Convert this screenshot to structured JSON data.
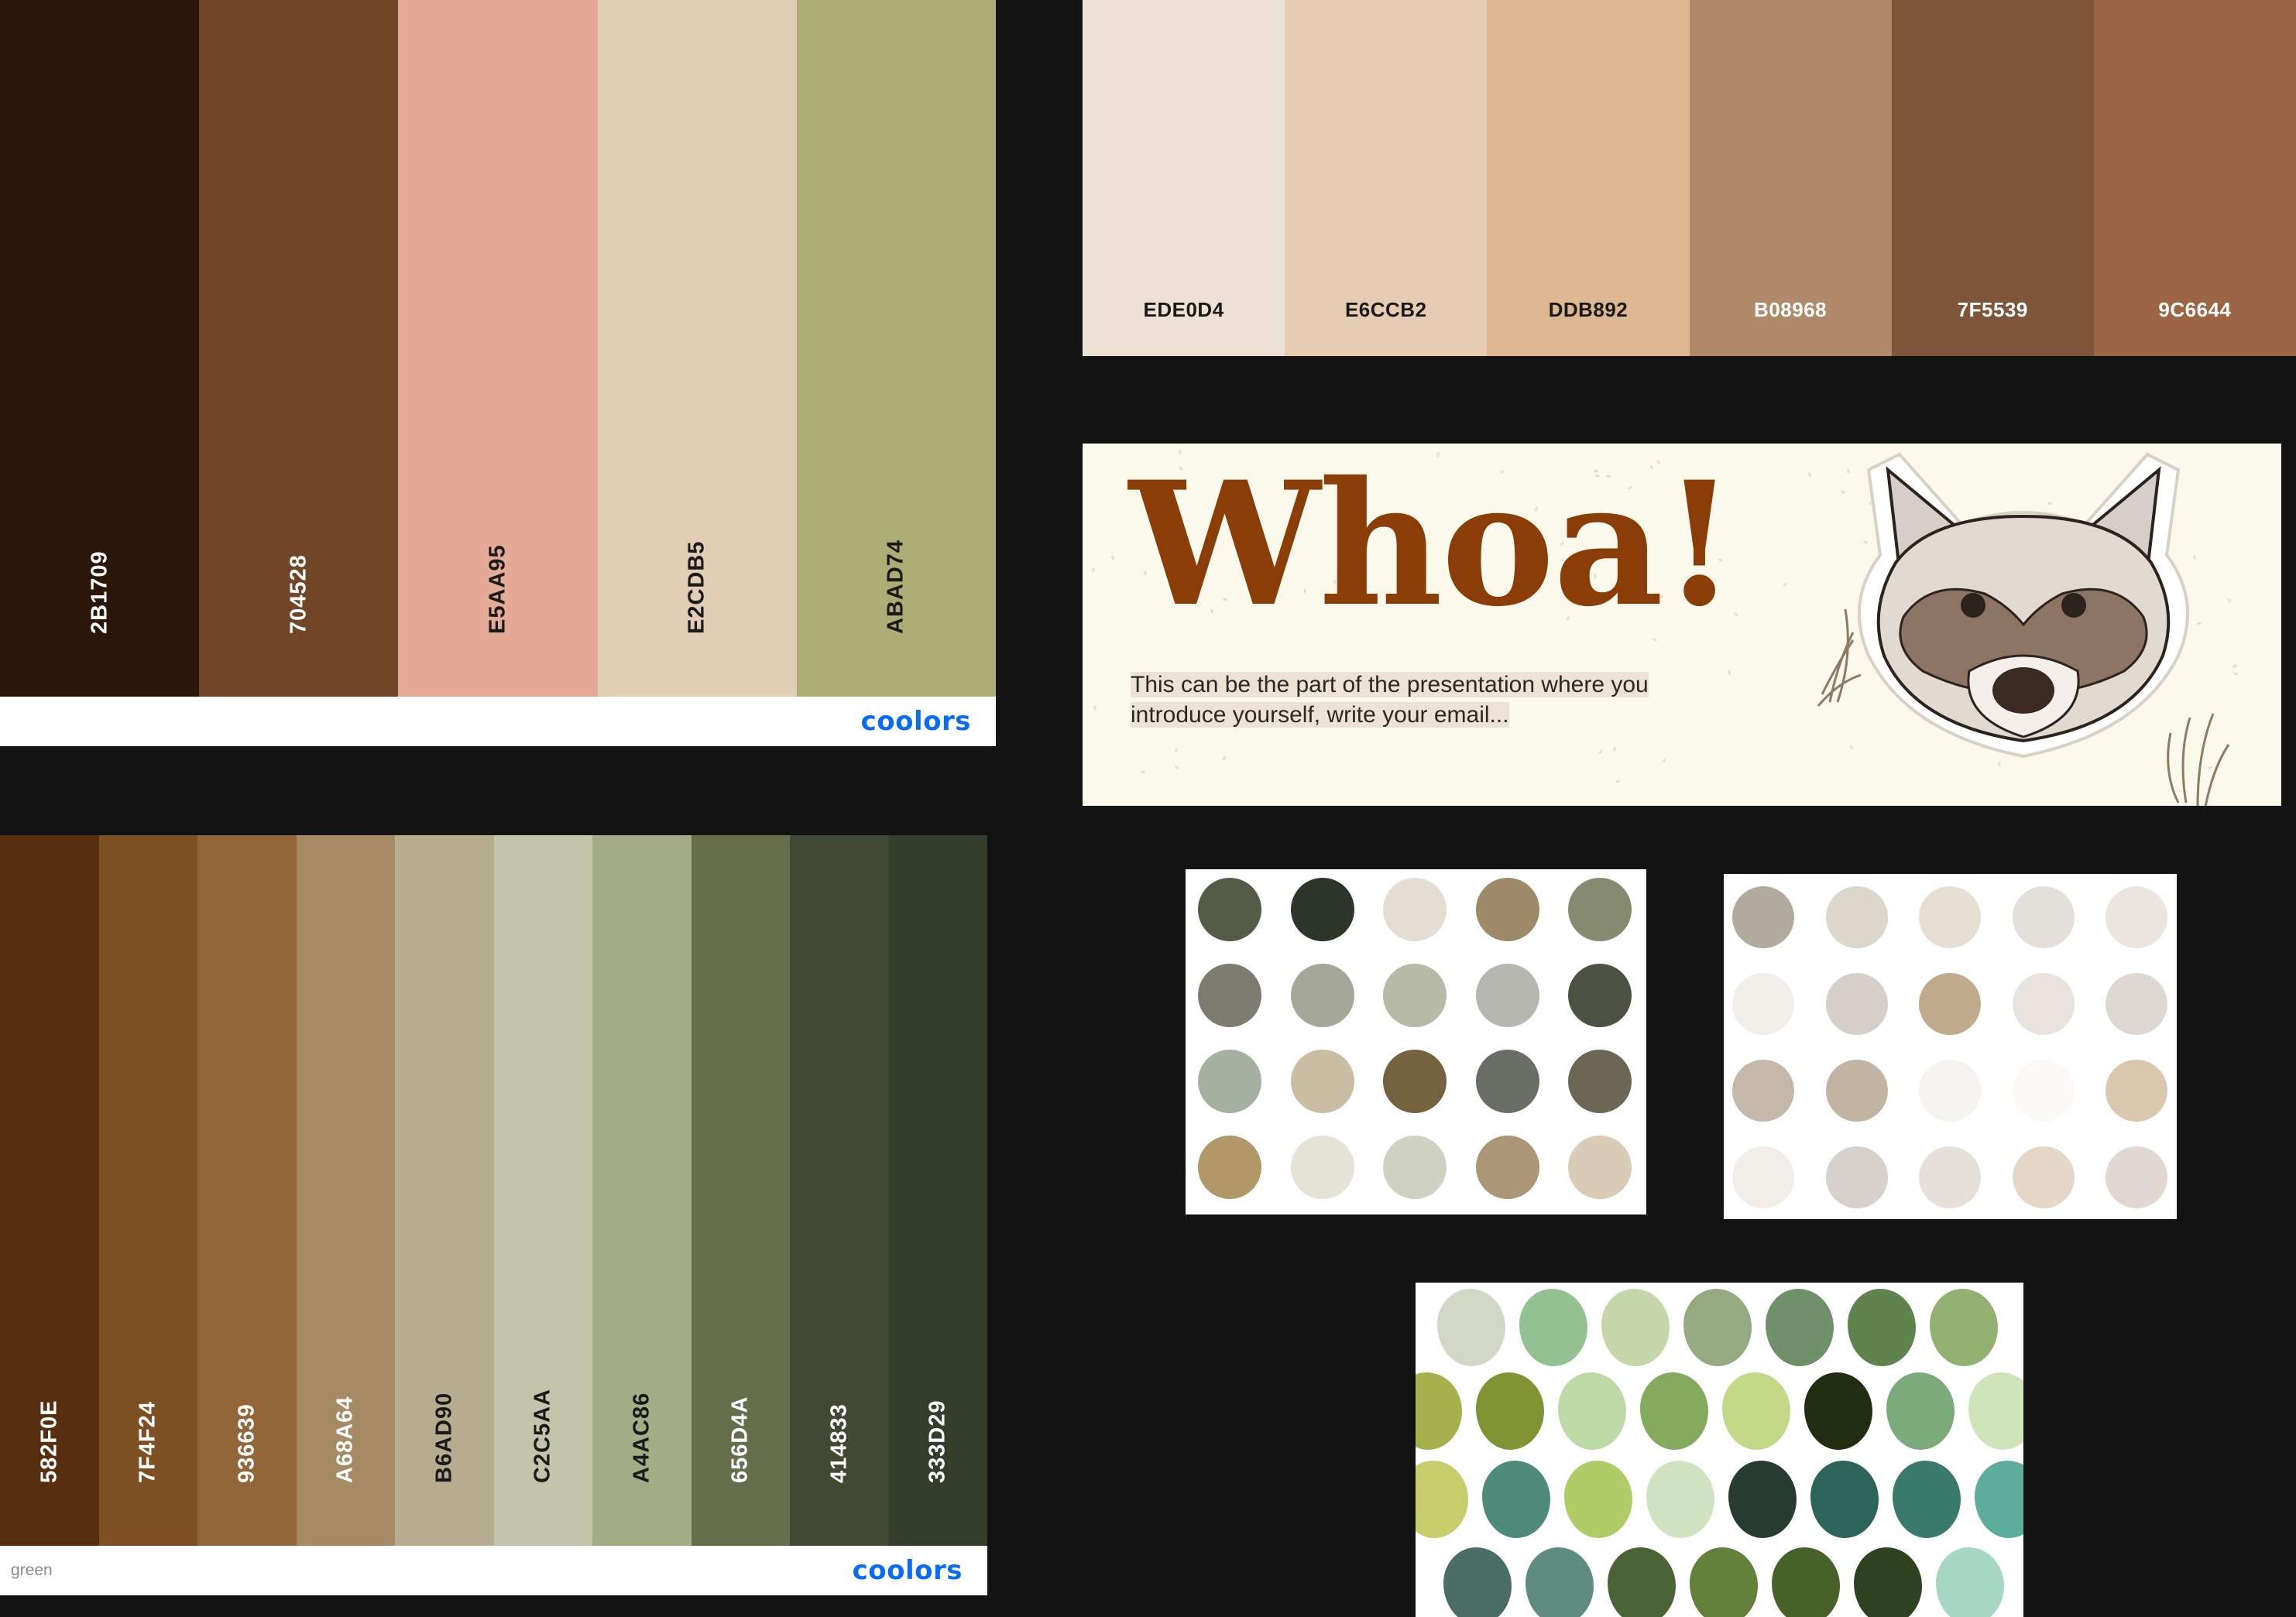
{
  "palette_brown": {
    "colors": [
      {
        "hex": "2B1709",
        "label": "2B1709",
        "text": "#ffffff"
      },
      {
        "hex": "704528",
        "label": "704528",
        "text": "#ffffff"
      },
      {
        "hex": "E5AA95",
        "label": "E5AA95",
        "text": "#1a1a1a"
      },
      {
        "hex": "E2CDB5",
        "label": "E2CDB5",
        "text": "#1a1a1a"
      },
      {
        "hex": "ABAD74",
        "label": "ABAD74",
        "text": "#1a1a1a"
      }
    ],
    "logo": "coolors"
  },
  "palette_green": {
    "colors": [
      {
        "hex": "582F0E",
        "label": "582F0E",
        "text": "#ffffff"
      },
      {
        "hex": "7F4F24",
        "label": "7F4F24",
        "text": "#ffffff"
      },
      {
        "hex": "936639",
        "label": "936639",
        "text": "#ffffff"
      },
      {
        "hex": "A68A64",
        "label": "A68A64",
        "text": "#ffffff"
      },
      {
        "hex": "B6AD90",
        "label": "B6AD90",
        "text": "#1a1a1a"
      },
      {
        "hex": "C2C5AA",
        "label": "C2C5AA",
        "text": "#1a1a1a"
      },
      {
        "hex": "A4AC86",
        "label": "A4AC86",
        "text": "#1a1a1a"
      },
      {
        "hex": "656D4A",
        "label": "656D4A",
        "text": "#ffffff"
      },
      {
        "hex": "414833",
        "label": "414833",
        "text": "#ffffff"
      },
      {
        "hex": "333D29",
        "label": "333D29",
        "text": "#ffffff"
      }
    ],
    "name": "green",
    "logo": "coolors"
  },
  "palette_neutral": {
    "colors": [
      {
        "hex": "EDE0D4",
        "label": "EDE0D4",
        "text": "#1a1a1a"
      },
      {
        "hex": "E6CCB2",
        "label": "E6CCB2",
        "text": "#1a1a1a"
      },
      {
        "hex": "DDB892",
        "label": "DDB892",
        "text": "#1a1a1a"
      },
      {
        "hex": "B08968",
        "label": "B08968",
        "text": "#ffffff"
      },
      {
        "hex": "7F5539",
        "label": "7F5539",
        "text": "#ffffff"
      },
      {
        "hex": "9C6644",
        "label": "9C6644",
        "text": "#ffffff"
      }
    ]
  },
  "whoa_card": {
    "title": "Whoa!",
    "line1": "This can be the part of the presentation where you",
    "line2": "introduce yourself, write your email...",
    "title_color": "#8a3d06"
  },
  "dots_olive": [
    "#545c48",
    "#2d3528",
    "#e3ddd3",
    "#9e8a68",
    "#868b70",
    "#7c7d70",
    "#a5a896",
    "#b7baa6",
    "#b6b8af",
    "#4c5143",
    "#a4b1a0",
    "#c9bea3",
    "#75623f",
    "#6a6d63",
    "#6d6655",
    "#b09869",
    "#e4e3d6",
    "#cfd2c1",
    "#ab9678",
    "#d9cbb5"
  ],
  "dots_beige": [
    "#b2aa9d",
    "#ddd6cb",
    "#e6dfd2",
    "#e3e0da",
    "#ebe5df",
    "#f1efe9",
    "#d6cfc7",
    "#bfab8b",
    "#e9e2dd",
    "#ddd8d2",
    "#c4b8aa",
    "#c3b3a1",
    "#f5f3f0",
    "#fbf9f6",
    "#d9c8ad",
    "#f1ede8",
    "#d6d1cb",
    "#e6e1d8",
    "#e5d8c7",
    "#e2d8d1"
  ],
  "dots_green": [
    "#d3d7c6",
    "#94c191",
    "#c5d7aa",
    "#95aa80",
    "#6f9169",
    "#5f834d",
    "#93b272",
    "#a6b04d",
    "#819433",
    "#bddaa6",
    "#84aa5d",
    "#c2d987",
    "#212d10",
    "#7bab7a",
    "#cde5b9",
    "#c8cd6b",
    "#4e8b78",
    "#b0cc66",
    "#d0e3c1",
    "#263c33",
    "#2c6459",
    "#397a6a",
    "#5cae9a",
    "#4a6e65",
    "#5e8c80",
    "#4a6337",
    "#63803a",
    "#466229",
    "#2d4320",
    "#a5d7c4"
  ]
}
